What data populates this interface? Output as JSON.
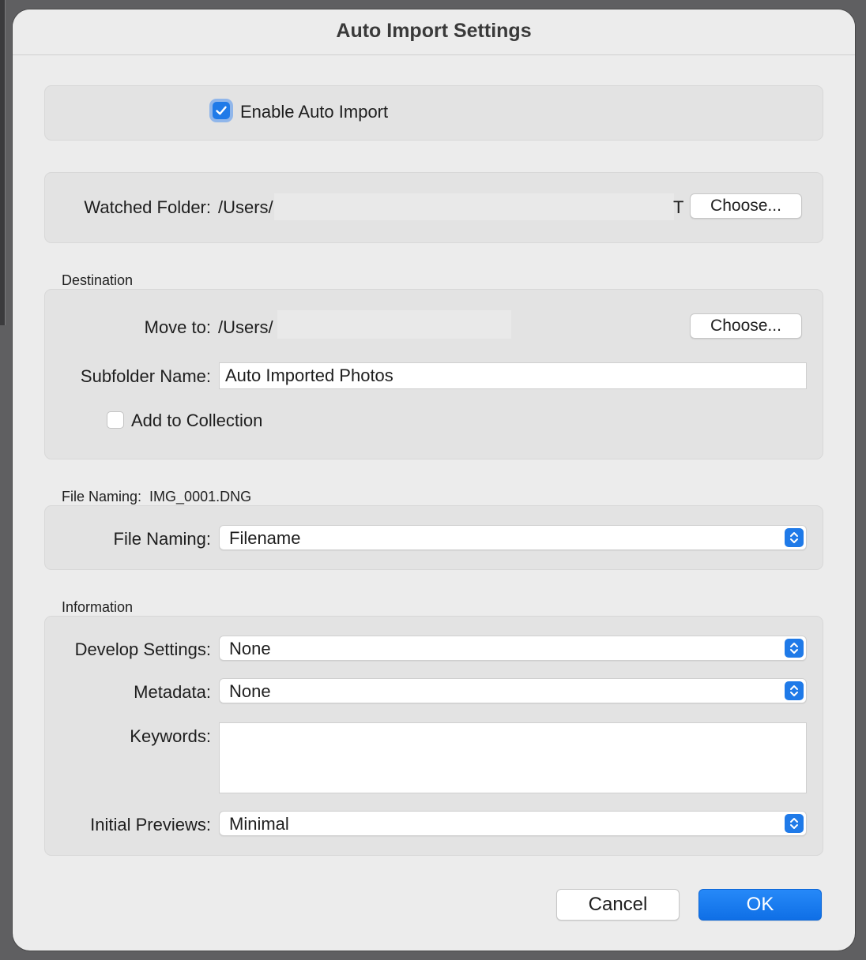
{
  "window": {
    "title": "Auto Import Settings"
  },
  "enable": {
    "label": "Enable Auto Import",
    "checked": true
  },
  "watched": {
    "label": "Watched Folder:",
    "path": "/Users/",
    "trailing": "T",
    "choose": "Choose..."
  },
  "destination": {
    "section": "Destination",
    "move_label": "Move to:",
    "move_path": "/Users/",
    "choose": "Choose...",
    "subfolder_label": "Subfolder Name:",
    "subfolder_value": "Auto Imported Photos",
    "collection_label": "Add to Collection",
    "collection_checked": false
  },
  "naming": {
    "section_label": "File Naming:",
    "section_example": "IMG_0001.DNG",
    "label": "File Naming:",
    "value": "Filename"
  },
  "information": {
    "section": "Information",
    "develop_label": "Develop Settings:",
    "develop_value": "None",
    "metadata_label": "Metadata:",
    "metadata_value": "None",
    "keywords_label": "Keywords:",
    "keywords_value": "",
    "previews_label": "Initial Previews:",
    "previews_value": "Minimal"
  },
  "footer": {
    "cancel": "Cancel",
    "ok": "OK"
  },
  "colors": {
    "accent": "#1f7ae8",
    "dialog_bg": "#ececec",
    "panel_bg": "#e3e3e3"
  },
  "icons": {
    "check": "checkmark-icon",
    "stepper": "chevron-up-down-icon"
  }
}
